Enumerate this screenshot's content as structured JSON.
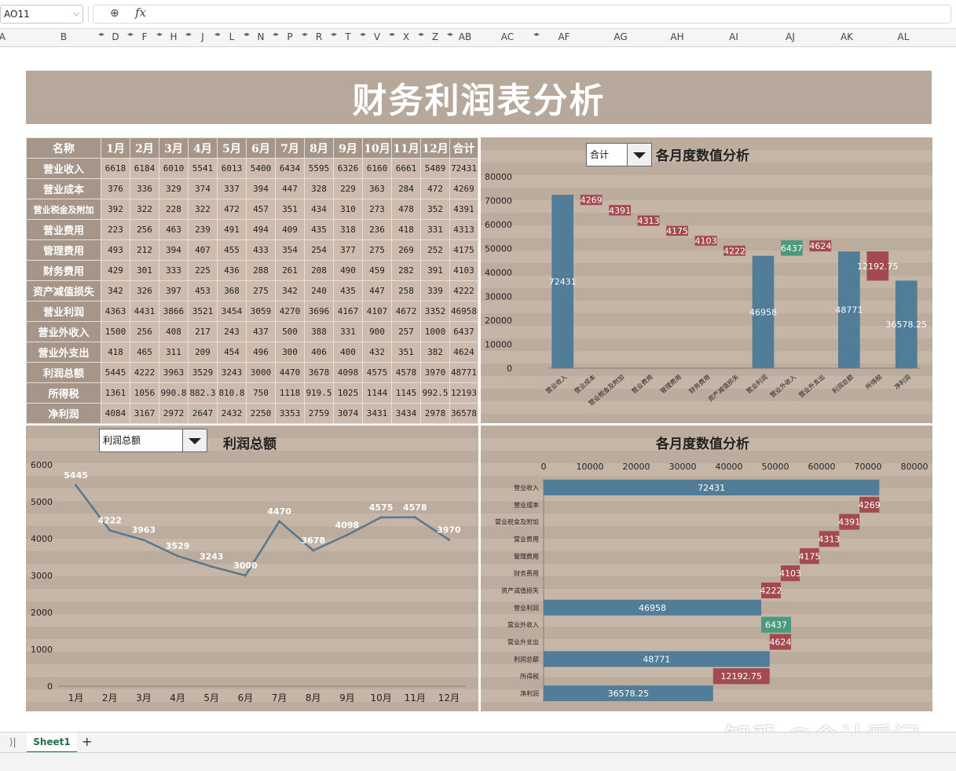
{
  "formula_bar": {
    "cell_ref": "AO11",
    "formula": ""
  },
  "columns": [
    "A",
    "B",
    "D",
    "F",
    "H",
    "J",
    "L",
    "N",
    "P",
    "R",
    "T",
    "V",
    "X",
    "Z",
    "AB",
    "AC",
    "AF",
    "AG",
    "AH",
    "AI",
    "AJ",
    "AK",
    "AL"
  ],
  "title": "财务利润表分析",
  "table": {
    "headers": [
      "名称",
      "1月",
      "2月",
      "3月",
      "4月",
      "5月",
      "6月",
      "7月",
      "8月",
      "9月",
      "10月",
      "11月",
      "12月",
      "合计"
    ],
    "rows": [
      {
        "label": "营业收入",
        "values": [
          "6618",
          "6184",
          "6010",
          "5541",
          "6013",
          "5400",
          "6434",
          "5595",
          "6326",
          "6160",
          "6661",
          "5489",
          "72431"
        ]
      },
      {
        "label": "营业成本",
        "values": [
          "376",
          "336",
          "329",
          "374",
          "337",
          "394",
          "447",
          "328",
          "229",
          "363",
          "284",
          "472",
          "4269"
        ]
      },
      {
        "label": "营业税金及附加",
        "values": [
          "392",
          "322",
          "228",
          "322",
          "472",
          "457",
          "351",
          "434",
          "310",
          "273",
          "478",
          "352",
          "4391"
        ]
      },
      {
        "label": "营业费用",
        "values": [
          "223",
          "256",
          "463",
          "239",
          "491",
          "494",
          "409",
          "435",
          "318",
          "236",
          "418",
          "331",
          "4313"
        ]
      },
      {
        "label": "管理费用",
        "values": [
          "493",
          "212",
          "394",
          "407",
          "455",
          "433",
          "354",
          "254",
          "377",
          "275",
          "269",
          "252",
          "4175"
        ]
      },
      {
        "label": "财务费用",
        "values": [
          "429",
          "301",
          "333",
          "225",
          "436",
          "288",
          "261",
          "208",
          "490",
          "459",
          "282",
          "391",
          "4103"
        ]
      },
      {
        "label": "资产减值损失",
        "values": [
          "342",
          "326",
          "397",
          "453",
          "368",
          "275",
          "342",
          "240",
          "435",
          "447",
          "258",
          "339",
          "4222"
        ]
      },
      {
        "label": "营业利润",
        "values": [
          "4363",
          "4431",
          "3866",
          "3521",
          "3454",
          "3059",
          "4270",
          "3696",
          "4167",
          "4107",
          "4672",
          "3352",
          "46958"
        ]
      },
      {
        "label": "营业外收入",
        "values": [
          "1500",
          "256",
          "408",
          "217",
          "243",
          "437",
          "500",
          "388",
          "331",
          "900",
          "257",
          "1000",
          "6437"
        ]
      },
      {
        "label": "营业外支出",
        "values": [
          "418",
          "465",
          "311",
          "209",
          "454",
          "496",
          "300",
          "406",
          "400",
          "432",
          "351",
          "382",
          "4624"
        ]
      },
      {
        "label": "利润总额",
        "values": [
          "5445",
          "4222",
          "3963",
          "3529",
          "3243",
          "3000",
          "4470",
          "3678",
          "4098",
          "4575",
          "4578",
          "3970",
          "48771"
        ]
      },
      {
        "label": "所得税",
        "values": [
          "1361",
          "1056",
          "990.8",
          "882.3",
          "810.8",
          "750",
          "1118",
          "919.5",
          "1025",
          "1144",
          "1145",
          "992.5",
          "12193"
        ]
      },
      {
        "label": "净利润",
        "values": [
          "4084",
          "3167",
          "2972",
          "2647",
          "2432",
          "2250",
          "3353",
          "2759",
          "3074",
          "3431",
          "3434",
          "2978",
          "36578"
        ]
      }
    ]
  },
  "waterfall_dropdown": "合计",
  "line_dropdown": "利润总额",
  "colors": {
    "positive": "#517d98",
    "negative": "#a34a51",
    "gain": "#4a9b7c",
    "line": "#58788e",
    "header": "#a6968a",
    "banner": "#b6a89b"
  },
  "chart_data": [
    {
      "type": "bar",
      "subtype": "waterfall",
      "title": "各月度数值分析",
      "categories": [
        "营业收入",
        "营业成本",
        "营业税金及附加",
        "营业费用",
        "管理费用",
        "财务费用",
        "资产减值损失",
        "营业利润",
        "营业外收入",
        "营业外支出",
        "利润总额",
        "所得税",
        "净利润"
      ],
      "values": [
        72431,
        4269,
        4391,
        4313,
        4175,
        4103,
        4222,
        46958,
        6437,
        4624,
        48771,
        12192.75,
        36578.25
      ],
      "value_labels": [
        "72431",
        "4269",
        "4391",
        "4313",
        "4175",
        "4103",
        "4222",
        "46958",
        "6437",
        "4624",
        "48771",
        "12192.75",
        "36578.25"
      ],
      "kind": [
        "total",
        "decrease",
        "decrease",
        "decrease",
        "decrease",
        "decrease",
        "decrease",
        "total",
        "increase",
        "decrease",
        "total",
        "decrease",
        "total"
      ],
      "ylim": [
        0,
        80000
      ],
      "yticks": [
        "0",
        "10000",
        "20000",
        "30000",
        "40000",
        "50000",
        "60000",
        "70000",
        "80000"
      ]
    },
    {
      "type": "line",
      "title": "利润总额",
      "categories": [
        "1月",
        "2月",
        "3月",
        "4月",
        "5月",
        "6月",
        "7月",
        "8月",
        "9月",
        "10月",
        "11月",
        "12月"
      ],
      "values": [
        5445,
        4222,
        3963,
        3529,
        3243,
        3000,
        4470,
        3678,
        4098,
        4575,
        4578,
        3970
      ],
      "ylim": [
        0,
        6000
      ],
      "yticks": [
        "0",
        "1000",
        "2000",
        "3000",
        "4000",
        "5000",
        "6000"
      ]
    },
    {
      "type": "bar",
      "subtype": "horizontal-waterfall",
      "title": "各月度数值分析",
      "categories": [
        "营业收入",
        "营业成本",
        "营业税金及附加",
        "营业费用",
        "管理费用",
        "财务费用",
        "资产减值损失",
        "营业利润",
        "营业外收入",
        "营业外支出",
        "利润总额",
        "所得税",
        "净利润"
      ],
      "values": [
        72431,
        4269,
        4391,
        4313,
        4175,
        4103,
        4222,
        46958,
        6437,
        4624,
        48771,
        12192.75,
        36578.25
      ],
      "value_labels": [
        "72431",
        "4269",
        "4391",
        "4313",
        "4175",
        "4103",
        "4222",
        "46958",
        "6437",
        "4624",
        "48771",
        "12192.75",
        "36578.25"
      ],
      "kind": [
        "total",
        "decrease",
        "decrease",
        "decrease",
        "decrease",
        "decrease",
        "decrease",
        "total",
        "increase",
        "decrease",
        "total",
        "decrease",
        "total"
      ],
      "xlim": [
        0,
        80000
      ],
      "xticks": [
        "0",
        "10000",
        "20000",
        "30000",
        "40000",
        "50000",
        "60000",
        "70000",
        "80000"
      ]
    }
  ],
  "sheet_tab": "Sheet1",
  "watermark": "知乎 @会计爱问"
}
